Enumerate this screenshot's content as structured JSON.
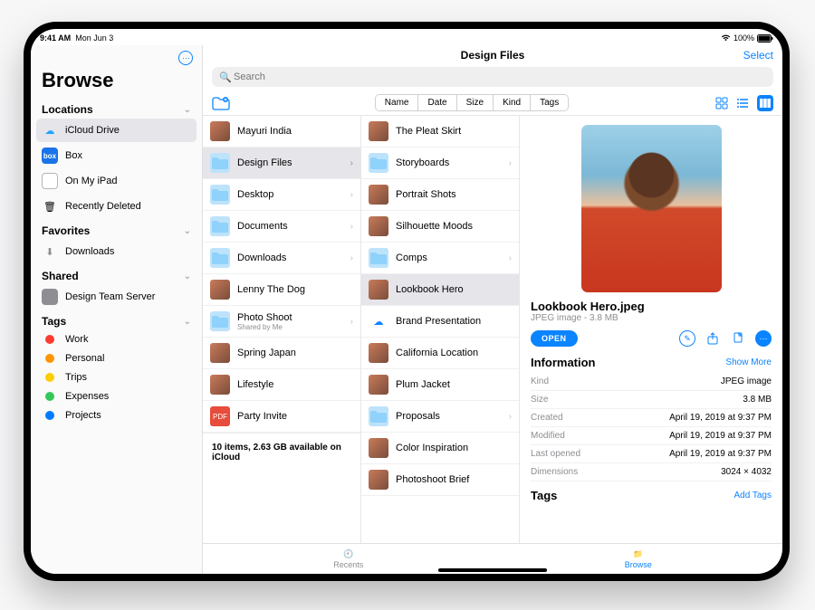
{
  "status": {
    "time": "9:41 AM",
    "date": "Mon Jun 3",
    "battery": "100%"
  },
  "sidebar": {
    "more_label": "⋯",
    "title": "Browse",
    "sections": {
      "locations": {
        "label": "Locations",
        "items": [
          {
            "label": "iCloud Drive"
          },
          {
            "label": "Box"
          },
          {
            "label": "On My iPad"
          },
          {
            "label": "Recently Deleted"
          }
        ]
      },
      "favorites": {
        "label": "Favorites",
        "items": [
          {
            "label": "Downloads"
          }
        ]
      },
      "shared": {
        "label": "Shared",
        "items": [
          {
            "label": "Design Team Server"
          }
        ]
      },
      "tags": {
        "label": "Tags",
        "items": [
          {
            "label": "Work",
            "color": "#ff3b30"
          },
          {
            "label": "Personal",
            "color": "#ff9500"
          },
          {
            "label": "Trips",
            "color": "#ffcc00"
          },
          {
            "label": "Expenses",
            "color": "#34c759"
          },
          {
            "label": "Projects",
            "color": "#007aff"
          }
        ]
      }
    }
  },
  "header": {
    "title": "Design Files",
    "select": "Select",
    "search_placeholder": "Search",
    "sort": {
      "name": "Name",
      "date": "Date",
      "size": "Size",
      "kind": "Kind",
      "tags": "Tags",
      "active": "Date"
    }
  },
  "col1": {
    "items": [
      {
        "label": "Mayuri India",
        "type": "img"
      },
      {
        "label": "Design Files",
        "type": "folder",
        "selected": true
      },
      {
        "label": "Desktop",
        "type": "folder"
      },
      {
        "label": "Documents",
        "type": "folder"
      },
      {
        "label": "Downloads",
        "type": "folder"
      },
      {
        "label": "Lenny The Dog",
        "type": "img"
      },
      {
        "label": "Photo Shoot",
        "type": "folder",
        "sub": "Shared by Me"
      },
      {
        "label": "Spring Japan",
        "type": "img"
      },
      {
        "label": "Lifestyle",
        "type": "img"
      },
      {
        "label": "Party Invite",
        "type": "pdf"
      }
    ],
    "footer": "10 items, 2.63 GB available on iCloud"
  },
  "col2": {
    "items": [
      {
        "label": "The Pleat Skirt",
        "type": "img"
      },
      {
        "label": "Storyboards",
        "type": "folder"
      },
      {
        "label": "Portrait Shots",
        "type": "img"
      },
      {
        "label": "Silhouette Moods",
        "type": "img"
      },
      {
        "label": "Comps",
        "type": "folder"
      },
      {
        "label": "Lookbook Hero",
        "type": "img",
        "selected": true
      },
      {
        "label": "Brand Presentation",
        "type": "cloud"
      },
      {
        "label": "California Location",
        "type": "img"
      },
      {
        "label": "Plum Jacket",
        "type": "img"
      },
      {
        "label": "Proposals",
        "type": "folder"
      },
      {
        "label": "Color Inspiration",
        "type": "img"
      },
      {
        "label": "Photoshoot Brief",
        "type": "img"
      }
    ]
  },
  "inspector": {
    "filename": "Lookbook Hero.jpeg",
    "subtitle": "JPEG image - 3.8 MB",
    "open": "OPEN",
    "info_header": "Information",
    "show_more": "Show More",
    "rows": {
      "kind": {
        "k": "Kind",
        "v": "JPEG image"
      },
      "size": {
        "k": "Size",
        "v": "3.8 MB"
      },
      "created": {
        "k": "Created",
        "v": "April 19, 2019 at 9:37 PM"
      },
      "modified": {
        "k": "Modified",
        "v": "April 19, 2019 at 9:37 PM"
      },
      "lastopened": {
        "k": "Last opened",
        "v": "April 19, 2019 at 9:37 PM"
      },
      "dimensions": {
        "k": "Dimensions",
        "v": "3024 × 4032"
      }
    },
    "tags_header": "Tags",
    "add_tags": "Add Tags"
  },
  "tabs": {
    "recents": "Recents",
    "browse": "Browse"
  }
}
